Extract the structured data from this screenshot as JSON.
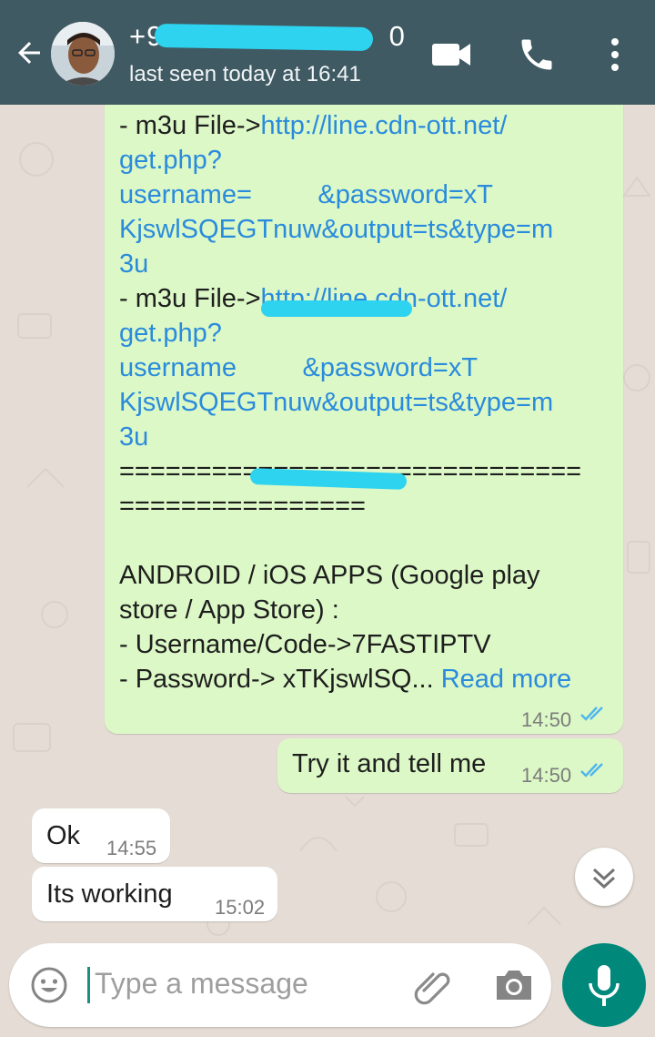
{
  "header": {
    "title": "+91",
    "title_tail": "0",
    "subtitle": "last seen today at 16:41"
  },
  "messages": {
    "big": {
      "lines": [
        {
          "plain": "- m3u File->",
          "link": "http://line.cdn-ott.net/"
        },
        {
          "plain": "",
          "link": "get.php?"
        },
        {
          "plain": "",
          "link": "username=         &password=xT"
        },
        {
          "plain": "",
          "link": "KjswlSQEGTnuw&output=ts&type=m"
        },
        {
          "plain": "",
          "link": "3u"
        },
        {
          "plain": "- m3u File->",
          "link": "http://line.cdn-ott.net/"
        },
        {
          "plain": "",
          "link": "get.php?"
        },
        {
          "plain": "",
          "link": "username         &password=xT"
        },
        {
          "plain": "",
          "link": "KjswlSQEGTnuw&output=ts&type=m"
        },
        {
          "plain": "",
          "link": "3u"
        },
        {
          "plain": "==============================",
          "link": ""
        },
        {
          "plain": "================",
          "link": ""
        },
        {
          "plain": "",
          "link": ""
        },
        {
          "plain": "ANDROID / iOS APPS (Google play",
          "link": ""
        },
        {
          "plain": "store / App Store) :",
          "link": ""
        },
        {
          "plain": "- Username/Code->7FASTIPTV",
          "link": ""
        }
      ],
      "last_line": "- Password-> xTKjswlSQ... ",
      "read_more": "Read more",
      "time": "14:50"
    },
    "reply": {
      "text": "Try it and tell me",
      "time": "14:50"
    },
    "ok": {
      "text": "Ok",
      "time": "14:55"
    },
    "working": {
      "text": "Its working",
      "time": "15:02"
    }
  },
  "input": {
    "placeholder": "Type a message"
  },
  "colors": {
    "header": "#3f5a63",
    "outgoing": "#dcf8c6",
    "incoming": "#ffffff",
    "link": "#2a8bdc",
    "accent": "#00897b",
    "tick": "#4fb6ec"
  },
  "icons": [
    "back-arrow-icon",
    "video-call-icon",
    "phone-icon",
    "more-vert-icon",
    "chevron-double-down-icon",
    "emoji-icon",
    "paperclip-icon",
    "camera-icon",
    "mic-icon",
    "double-check-icon"
  ]
}
